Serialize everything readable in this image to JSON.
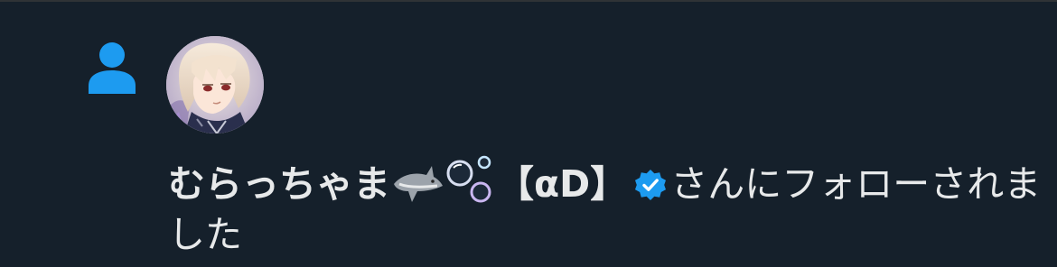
{
  "notification": {
    "user_name": "むらっちゃま",
    "user_tag": "【αD】",
    "action_text": "さんにフォローされました"
  },
  "icons": {
    "notification_type": "person-follow-icon",
    "name_emojis": [
      "shark-emoji",
      "bubbles-emoji"
    ],
    "badge": "verified-badge-icon"
  },
  "colors": {
    "background": "#15202b",
    "text": "#e7e9ea",
    "accent_blue": "#1d9bf0"
  }
}
